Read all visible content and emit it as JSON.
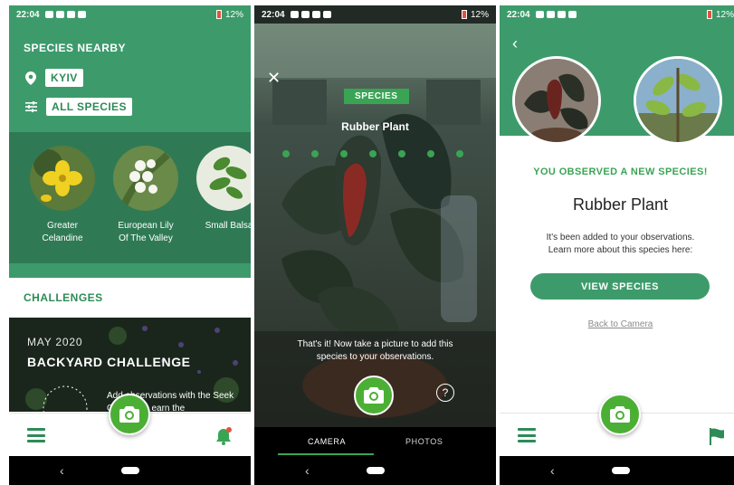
{
  "statusbar": {
    "time": "22:04",
    "battery": "12%"
  },
  "screen1": {
    "nearby_title": "SPECIES NEARBY",
    "location_chip": "KYIV",
    "filter_chip": "ALL SPECIES",
    "species": [
      {
        "name": "Greater Celandine"
      },
      {
        "name": "European Lily Of The Valley"
      },
      {
        "name": "Small Balsa"
      }
    ],
    "challenges_title": "CHALLENGES",
    "challenge": {
      "month": "MAY 2020",
      "title": "BACKYARD CHALLENGE",
      "description": "Add observations with the Seek Camera to earn the"
    }
  },
  "screen2": {
    "pill": "SPECIES",
    "species_name": "Rubber Plant",
    "progress_steps_total": 7,
    "progress_steps_filled": 0,
    "message": "That's it! Now take a picture to add this species to your observations.",
    "help": "?",
    "tabs": [
      {
        "label": "CAMERA",
        "active": true
      },
      {
        "label": "PHOTOS",
        "active": false
      }
    ]
  },
  "screen3": {
    "observed": "YOU OBSERVED A NEW SPECIES!",
    "species_name": "Rubber Plant",
    "description": "It's been added to your observations. Learn more about this species here:",
    "view_button": "VIEW SPECIES",
    "back_link": "Back to Camera"
  },
  "colors": {
    "header_green": "#3d9b6b",
    "dark_green": "#2f7a55",
    "accent_green": "#3aa455",
    "fab_green": "#4caf35",
    "text_green": "#2e8b57"
  }
}
